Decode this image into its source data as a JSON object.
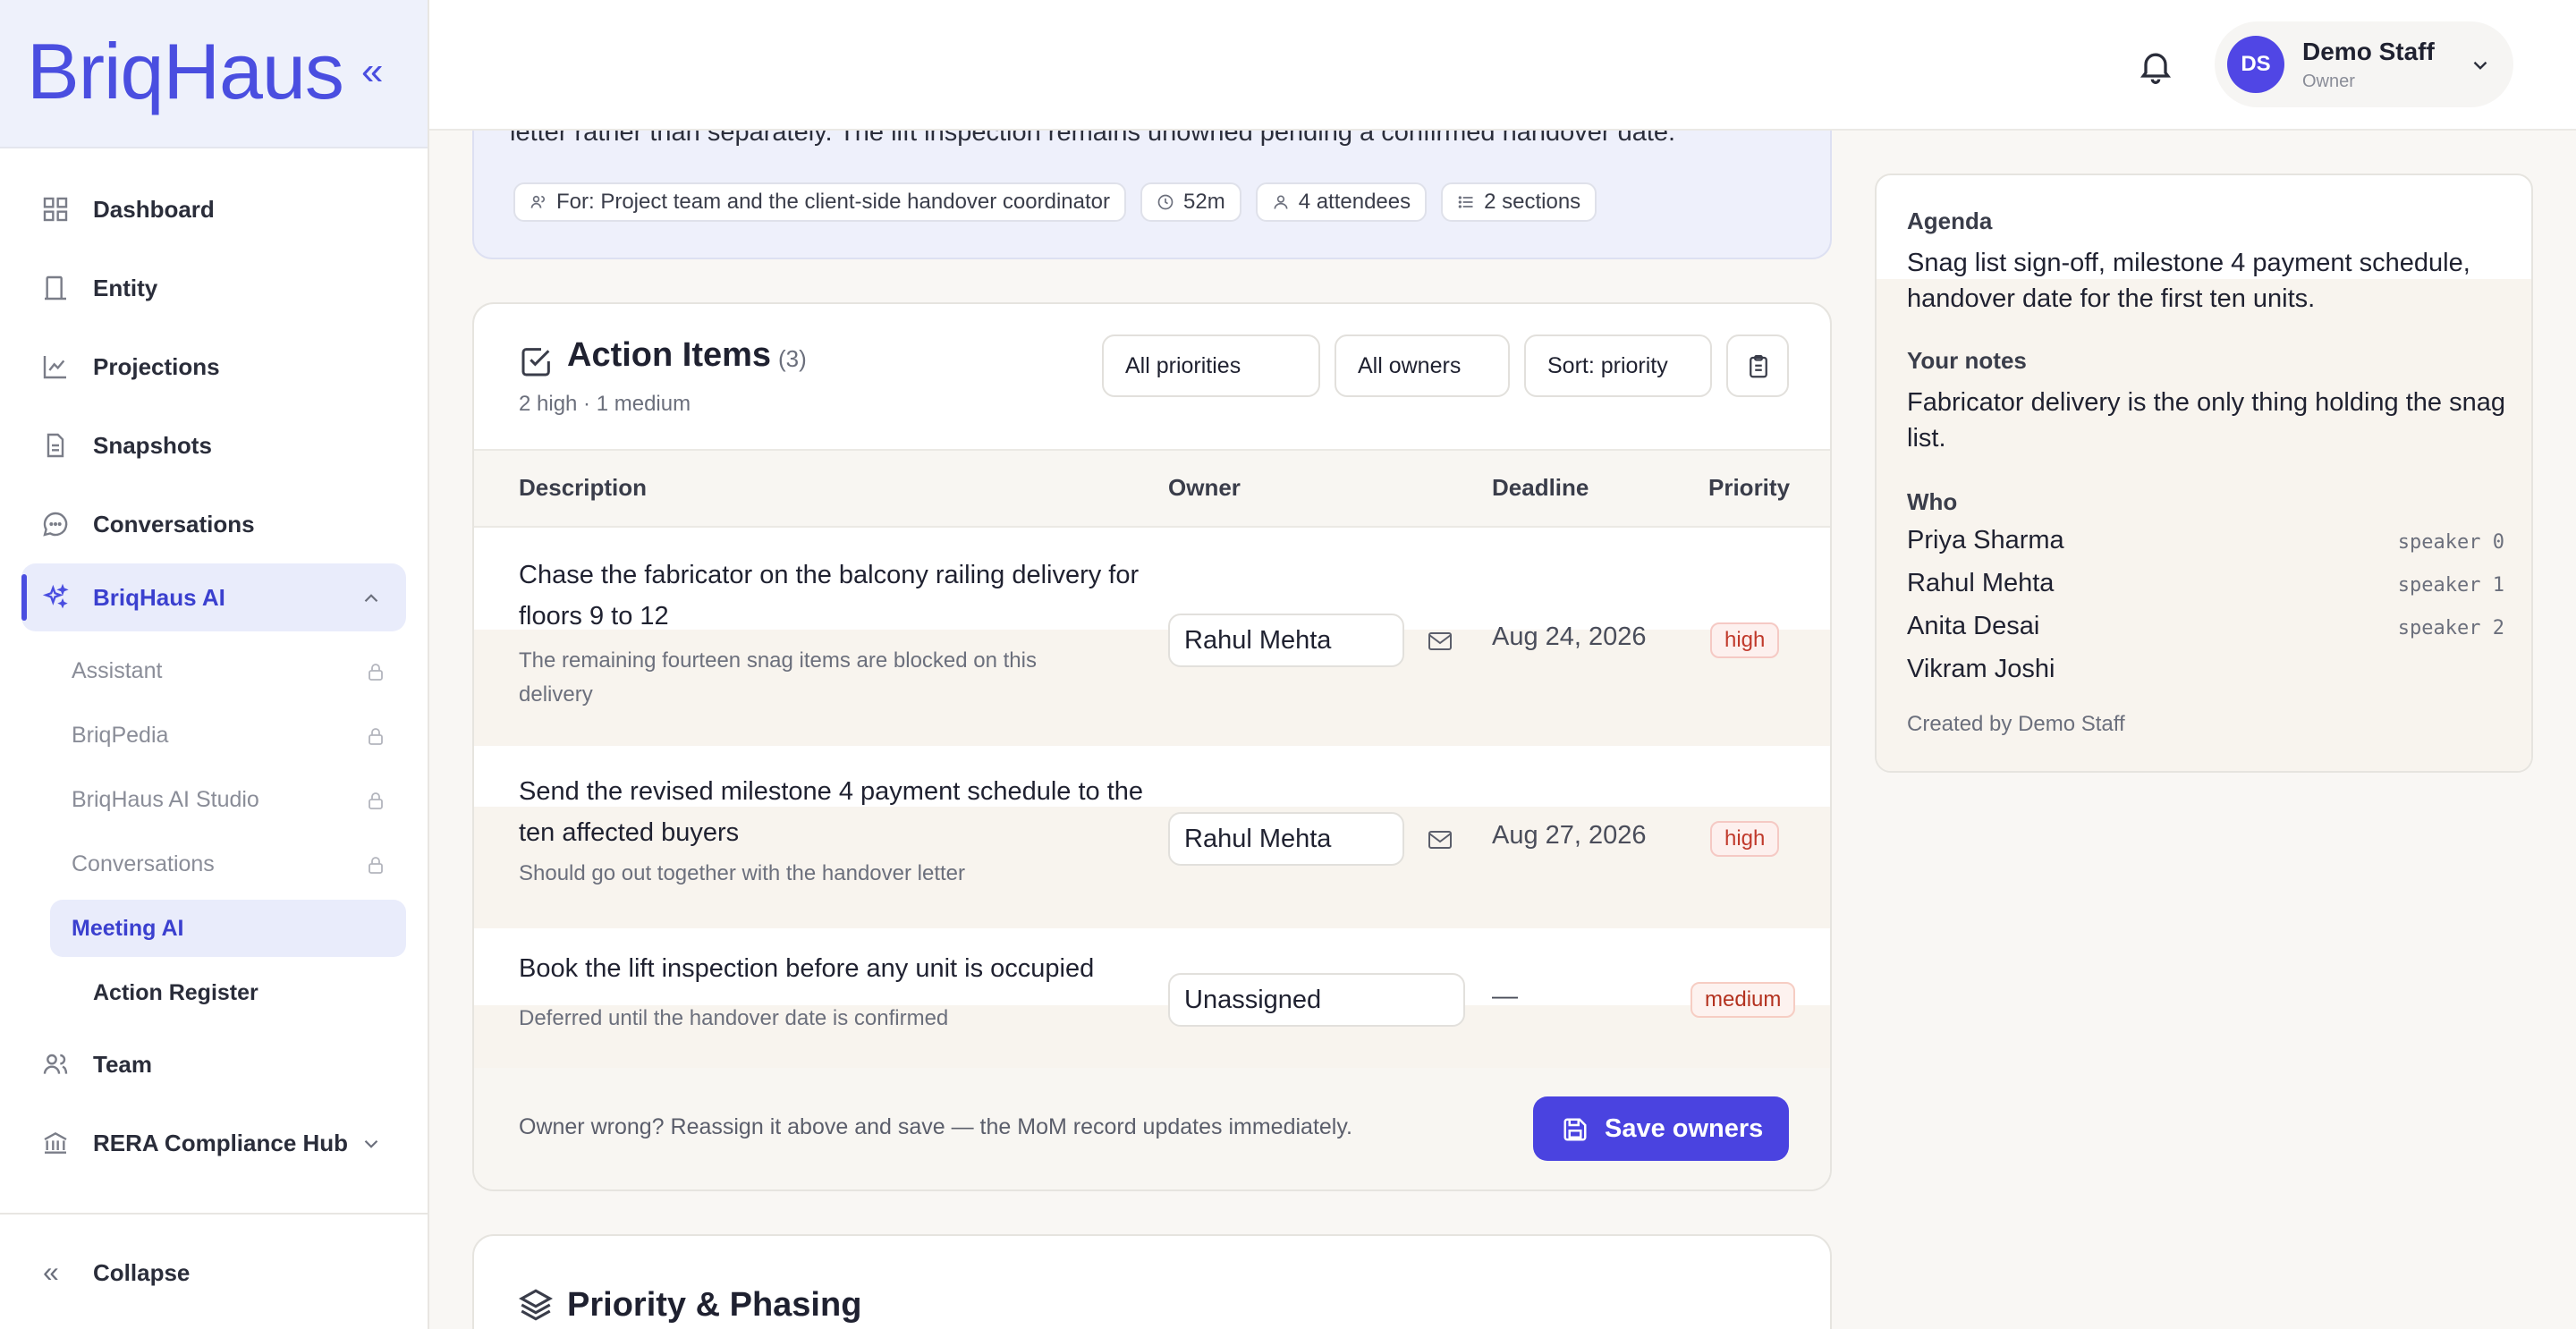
{
  "brand": {
    "name": "BriqHaus",
    "collapse_glyph": "«"
  },
  "sidebar": {
    "items": [
      {
        "label": "Dashboard",
        "icon": "grid-icon"
      },
      {
        "label": "Entity",
        "icon": "building-icon"
      },
      {
        "label": "Projections",
        "icon": "chart-line-icon"
      },
      {
        "label": "Snapshots",
        "icon": "document-icon"
      },
      {
        "label": "Conversations",
        "icon": "chat-icon"
      },
      {
        "label": "BriqHaus AI",
        "icon": "sparkles-icon"
      }
    ],
    "sub_items": [
      {
        "label": "Assistant",
        "locked": true
      },
      {
        "label": "BriqPedia",
        "locked": true
      },
      {
        "label": "BriqHaus AI Studio",
        "locked": true
      },
      {
        "label": "Conversations",
        "locked": true
      },
      {
        "label": "Meeting AI",
        "current": true
      },
      {
        "label": "Action Register"
      }
    ],
    "lower_items": [
      {
        "label": "Team",
        "icon": "users-icon"
      },
      {
        "label": "RERA Compliance Hub",
        "icon": "bank-icon"
      }
    ],
    "collapse_label": "Collapse"
  },
  "topbar": {
    "user": {
      "initials": "DS",
      "name": "Demo Staff",
      "role": "Owner"
    }
  },
  "summary": {
    "text": "letter rather than separately. The lift inspection remains unowned pending a confirmed handover date.",
    "chips": [
      "For: Project team and the client-side handover coordinator",
      "52m",
      "4 attendees",
      "2 sections"
    ]
  },
  "action_items": {
    "title": "Action Items",
    "count": "(3)",
    "subtitle": "2 high · 1 medium",
    "filters": {
      "priority": "All priorities",
      "owner": "All owners",
      "sort": "Sort: priority"
    },
    "columns": {
      "description": "Description",
      "owner": "Owner",
      "deadline": "Deadline",
      "priority": "Priority"
    },
    "rows": [
      {
        "description": "Chase the fabricator on the balcony railing delivery for floors 9 to 12",
        "note": "The remaining fourteen snag items are blocked on this delivery",
        "owner": "Rahul Mehta",
        "deadline": "Aug 24, 2026",
        "priority": "high"
      },
      {
        "description": "Send the revised milestone 4 payment schedule to the ten affected buyers",
        "note": "Should go out together with the handover letter",
        "owner": "Rahul Mehta",
        "deadline": "Aug 27, 2026",
        "priority": "high"
      },
      {
        "description": "Book the lift inspection before any unit is occupied",
        "note": "Deferred until the handover date is confirmed",
        "owner": "Unassigned",
        "deadline": "—",
        "priority": "medium"
      }
    ],
    "footer_hint": "Owner wrong? Reassign it above and save — the MoM record updates immediately.",
    "save_label": "Save owners"
  },
  "priority_section": {
    "title": "Priority & Phasing"
  },
  "right_panel": {
    "agenda_label": "Agenda",
    "agenda_text": "Snag list sign-off, milestone 4 payment schedule, handover date for the first ten units.",
    "notes_label": "Your notes",
    "notes_text": "Fabricator delivery is the only thing holding the snag list.",
    "who_label": "Who",
    "people": [
      {
        "name": "Priya Sharma",
        "tag": "speaker 0"
      },
      {
        "name": "Rahul Mehta",
        "tag": "speaker 1"
      },
      {
        "name": "Anita Desai",
        "tag": "speaker 2"
      },
      {
        "name": "Vikram Joshi",
        "tag": ""
      }
    ],
    "created_by": "Created by Demo Staff"
  },
  "colors": {
    "accent": "#4a43e0",
    "high": "#c0392b",
    "medium": "#b3321f"
  }
}
